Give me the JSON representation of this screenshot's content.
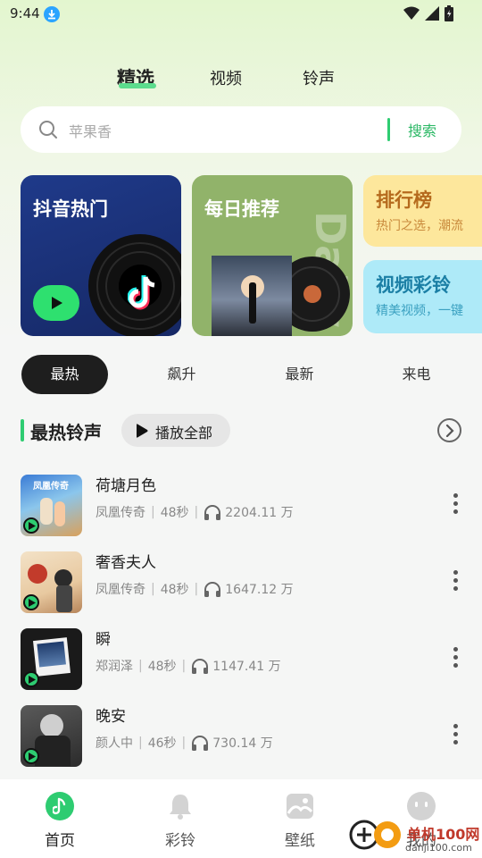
{
  "status_bar": {
    "time": "9:44",
    "icons": [
      "download-icon",
      "wifi-icon",
      "signal-icon",
      "battery-icon"
    ]
  },
  "top_tabs": [
    {
      "label": "精选",
      "active": true
    },
    {
      "label": "视频",
      "active": false
    },
    {
      "label": "铃声",
      "active": false
    }
  ],
  "search": {
    "placeholder": "苹果香",
    "button_label": "搜索"
  },
  "cards": {
    "douyin": {
      "title": "抖音热门"
    },
    "daily": {
      "title": "每日推荐",
      "watermark": "Daily"
    },
    "ranking": {
      "title": "排行榜",
      "subtitle": "热门之选，潮流"
    },
    "video_ring": {
      "title": "视频彩铃",
      "subtitle": "精美视频，一键"
    }
  },
  "filters": [
    {
      "label": "最热",
      "active": true
    },
    {
      "label": "飙升",
      "active": false
    },
    {
      "label": "最新",
      "active": false
    },
    {
      "label": "来电",
      "active": false
    }
  ],
  "section": {
    "title": "最热铃声",
    "play_all_label": "播放全部"
  },
  "songs": [
    {
      "title": "荷塘月色",
      "artist": "凤凰传奇",
      "duration": "48秒",
      "plays": "2204.11 万",
      "cover_text": "凤凰传奇"
    },
    {
      "title": "奢香夫人",
      "artist": "凤凰传奇",
      "duration": "48秒",
      "plays": "1647.12 万",
      "cover_text": ""
    },
    {
      "title": "瞬",
      "artist": "郑润泽",
      "duration": "48秒",
      "plays": "1147.41 万",
      "cover_text": ""
    },
    {
      "title": "晚安",
      "artist": "颜人中",
      "duration": "46秒",
      "plays": "730.14 万",
      "cover_text": ""
    }
  ],
  "bottom_nav": [
    {
      "label": "首页",
      "icon": "music-note-icon",
      "active": true
    },
    {
      "label": "彩铃",
      "icon": "bell-icon",
      "active": false
    },
    {
      "label": "壁纸",
      "icon": "wallpaper-icon",
      "active": false
    },
    {
      "label": "我的",
      "icon": "profile-icon",
      "active": false
    }
  ],
  "watermark_text": "单机100网",
  "watermark_url": "danji100.com",
  "colors": {
    "accent": "#2ecc71",
    "accent_text": "#2bb865",
    "dark_pill": "#1e1e1e"
  }
}
